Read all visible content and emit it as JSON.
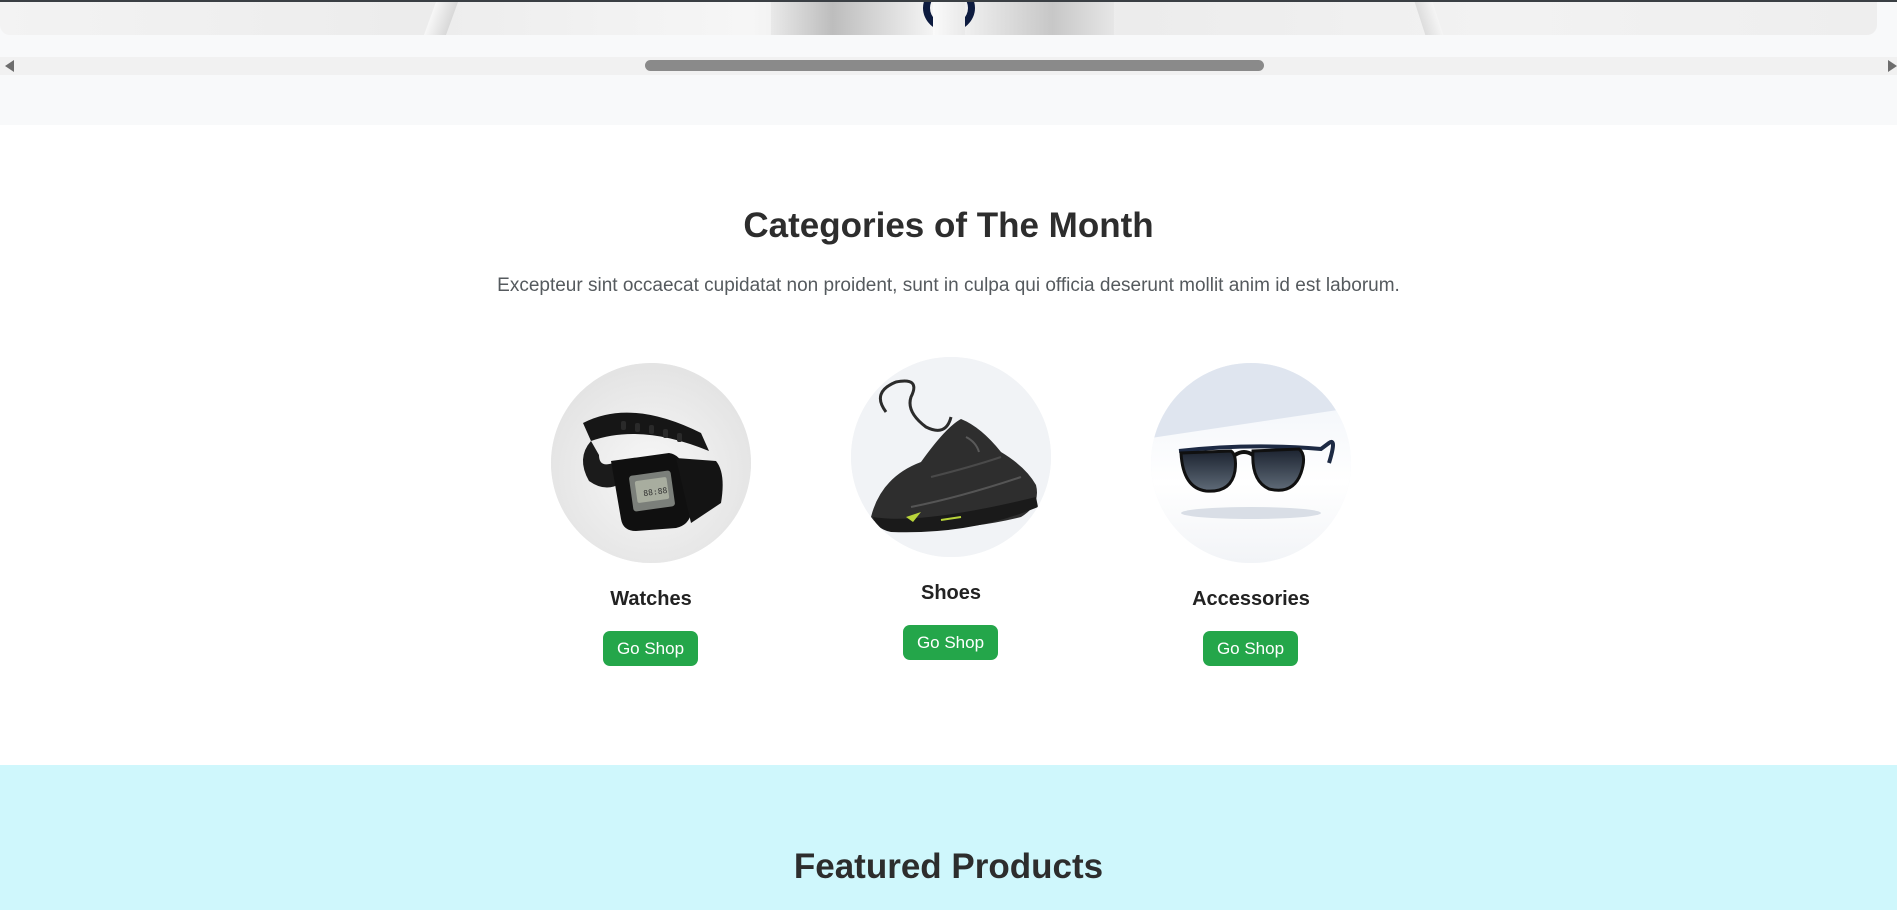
{
  "hero": {
    "image": "hero-product-image"
  },
  "categories": {
    "title": "Categories of The Month",
    "description": "Excepteur sint occaecat cupidatat non proident, sunt in culpa qui officia deserunt mollit anim id est laborum.",
    "items": [
      {
        "name": "Watches",
        "button_label": "Go Shop",
        "image": "watch-image"
      },
      {
        "name": "Shoes",
        "button_label": "Go Shop",
        "image": "shoe-image"
      },
      {
        "name": "Accessories",
        "button_label": "Go Shop",
        "image": "sunglasses-image"
      }
    ]
  },
  "featured": {
    "title": "Featured Products"
  },
  "colors": {
    "button_bg": "#24a64a",
    "featured_bg": "#cff7fc",
    "heading": "#2d2d2d"
  }
}
